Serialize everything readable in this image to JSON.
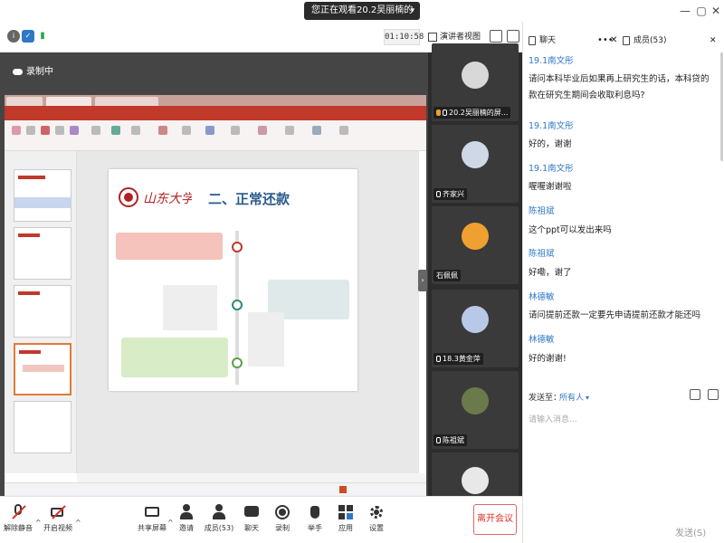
{
  "titlebar": {
    "viewing_text": "您正在观看20.2吴丽楠的屏幕"
  },
  "meetbar": {
    "timer": "01:10:58",
    "view_label": "演讲者视图",
    "recording_label": "录制中"
  },
  "participants": [
    {
      "name": "20.2吴丽楠的屏..."
    },
    {
      "name": "齐家兴"
    },
    {
      "name": "石佩佩"
    },
    {
      "name": "18.3黄金萍"
    },
    {
      "name": "陈祖斌"
    }
  ],
  "panel": {
    "tab_chat": "聊天",
    "tab_members": "成员(53)",
    "send_to_label": "发送至：",
    "send_to_value": "所有人",
    "input_placeholder": "请输入消息...",
    "send_button": "发送(S)"
  },
  "chat": [
    {
      "sender": "19.1南文彤",
      "text": "请问本科毕业后如果再上研究生的话，本科贷的款在研究生期间会收取利息吗?"
    },
    {
      "sender": "19.1南文彤",
      "text": "好的，谢谢"
    },
    {
      "sender": "19.1南文彤",
      "text": "喔喔谢谢啦"
    },
    {
      "sender": "陈祖斌",
      "text": "这个ppt可以发出来吗"
    },
    {
      "sender": "陈祖斌",
      "text": "好嘞，谢了"
    },
    {
      "sender": "林德敏",
      "text": "请问提前还款一定要先申请提前还款才能还吗"
    },
    {
      "sender": "林德敏",
      "text": "好的谢谢!"
    }
  ],
  "slide": {
    "logo_text": "山东大学",
    "title": "二、正常还款"
  },
  "bottom": {
    "mute": "解除静音",
    "video": "开启视频",
    "share": "共享屏幕",
    "invite": "邀请",
    "members": "成员(53)",
    "chat": "聊天",
    "record": "录制",
    "raise": "举手",
    "apps": "应用",
    "settings": "设置",
    "leave": "离开会议"
  },
  "colors": {
    "accent_blue": "#2e78c7",
    "leave_red": "#d93025",
    "ppt_red": "#c0392b"
  }
}
